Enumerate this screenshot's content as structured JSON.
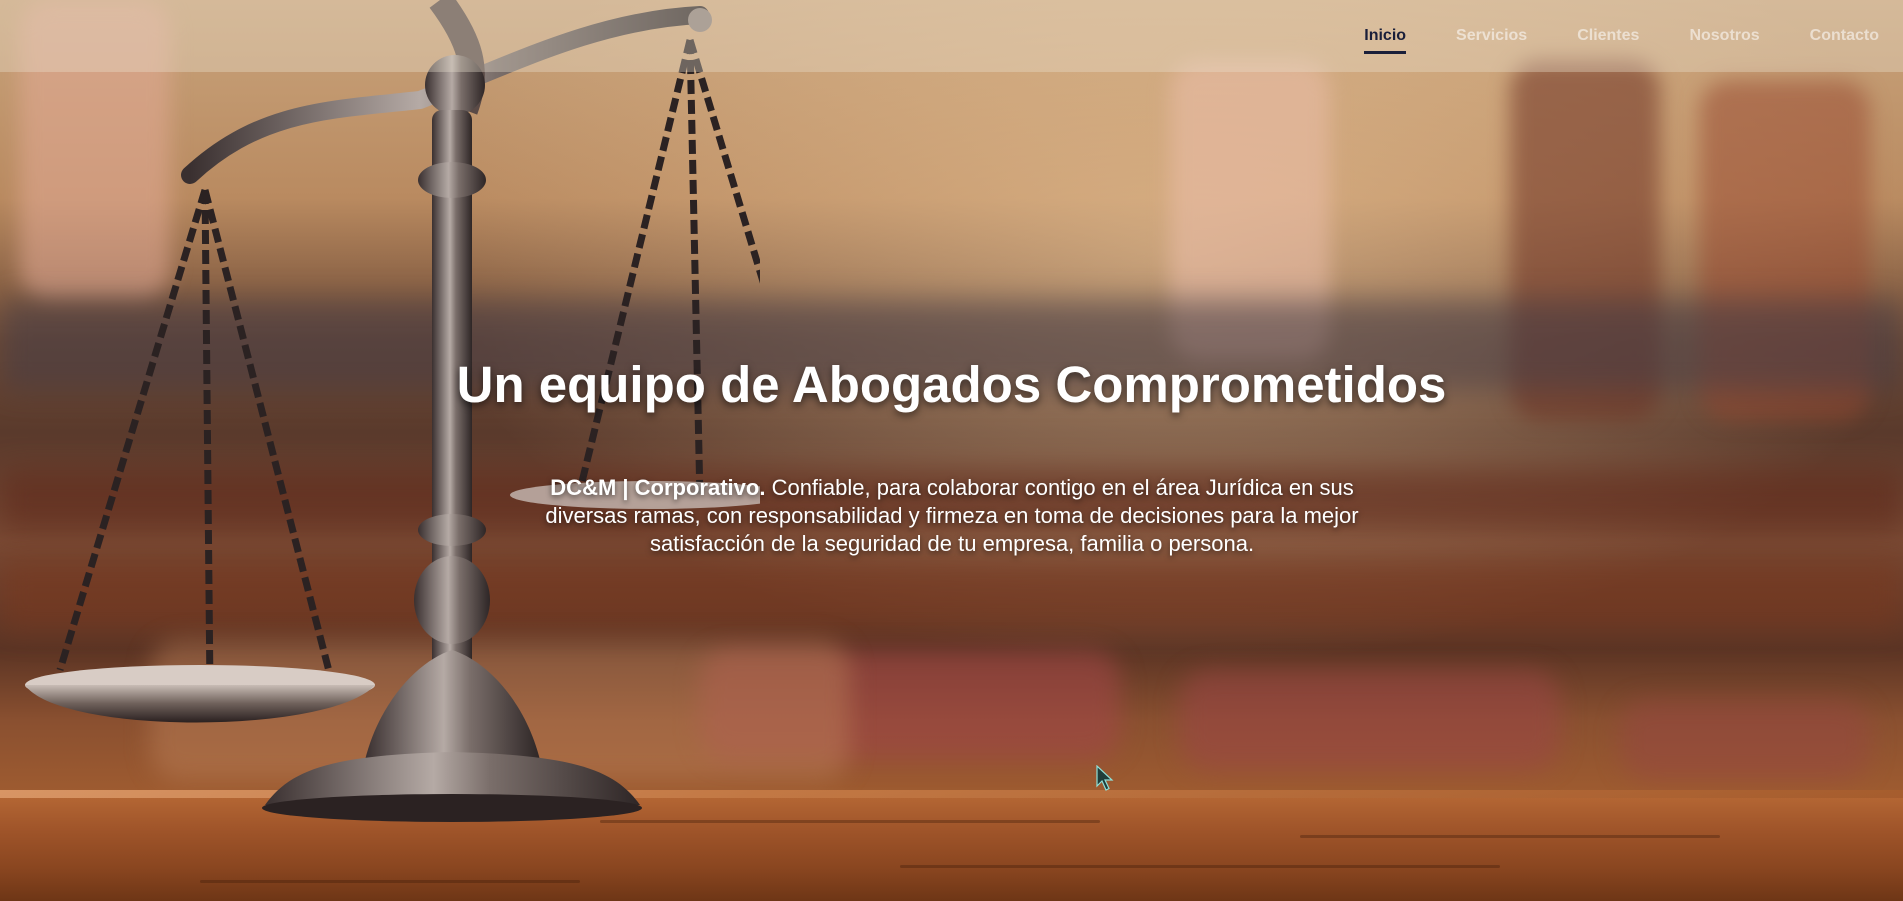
{
  "nav": {
    "items": [
      {
        "label": "Inicio",
        "active": true
      },
      {
        "label": "Servicios",
        "active": false
      },
      {
        "label": "Clientes",
        "active": false
      },
      {
        "label": "Nosotros",
        "active": false
      },
      {
        "label": "Contacto",
        "active": false
      }
    ],
    "active_color": "#1a1f3a"
  },
  "hero": {
    "title": "Un equipo de Abogados Comprometidos",
    "tagline_strong": "DC&M | Corporativo.",
    "tagline_text": " Confiable, para colaborar contigo en el área Jurídica en sus diversas ramas, con responsabilidad y firmeza en toma de decisiones para la mejor satisfacción de la seguridad de tu empresa, familia o persona."
  }
}
